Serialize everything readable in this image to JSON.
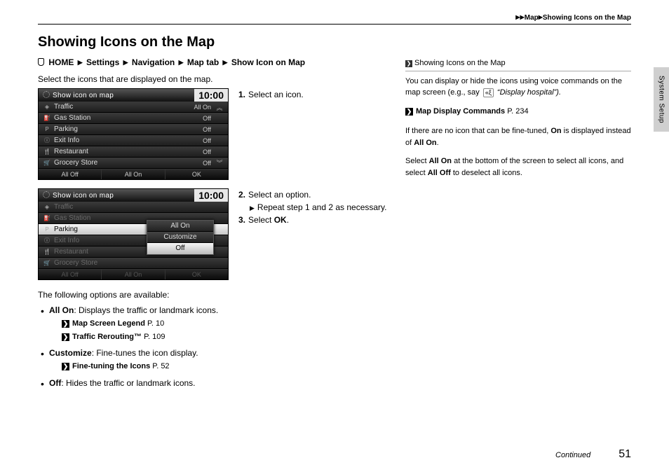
{
  "runhead": {
    "a": "Map",
    "b": "Showing Icons on the Map"
  },
  "title": "Showing Icons on the Map",
  "breadcrumb": [
    "HOME",
    "Settings",
    "Navigation",
    "Map",
    "tab",
    "Show Icon on Map"
  ],
  "intro": "Select the icons that are displayed on the map.",
  "shot1": {
    "title": "Show icon on map",
    "clock": "10:00",
    "rows": [
      {
        "icon": "◈",
        "label": "Traffic",
        "value": "All On"
      },
      {
        "icon": "⛽",
        "label": "Gas Station",
        "value": "Off"
      },
      {
        "icon": "P",
        "label": "Parking",
        "value": "Off"
      },
      {
        "icon": "ⓘ",
        "label": "Exit Info",
        "value": "Off"
      },
      {
        "icon": "🍴",
        "label": "Restaurant",
        "value": "Off"
      },
      {
        "icon": "🛒",
        "label": "Grocery Store",
        "value": "Off"
      }
    ],
    "footer": [
      "All Off",
      "All On",
      "OK"
    ]
  },
  "step1": "Select an icon.",
  "shot2": {
    "title": "Show icon on map",
    "clock": "10:00",
    "rows": [
      {
        "icon": "◈",
        "label": "Traffic",
        "value": ""
      },
      {
        "icon": "⛽",
        "label": "Gas Station",
        "value": ""
      },
      {
        "icon": "P",
        "label": "Parking",
        "value": ""
      },
      {
        "icon": "ⓘ",
        "label": "Exit Info",
        "value": ""
      },
      {
        "icon": "🍴",
        "label": "Restaurant",
        "value": ""
      },
      {
        "icon": "🛒",
        "label": "Grocery Store",
        "value": ""
      }
    ],
    "popup": [
      "All On",
      "Customize",
      "Off"
    ],
    "footer": [
      "All Off",
      "All On",
      "OK"
    ]
  },
  "step2a": "Select an option.",
  "step2b": "Repeat step 1 and 2 as necessary.",
  "step3": "Select OK.",
  "below_lead": "The following options are available:",
  "options": [
    {
      "name": "All On",
      "desc": ": Displays the traffic or landmark icons.",
      "xref": [
        {
          "t": "Map Screen Legend",
          "p": "P. 10"
        },
        {
          "t": "Traffic Rerouting™",
          "p": "P. 109"
        }
      ]
    },
    {
      "name": "Customize",
      "desc": ": Fine-tunes the icon display.",
      "xref": [
        {
          "t": "Fine-tuning the Icons",
          "p": "P. 52"
        }
      ]
    },
    {
      "name": "Off",
      "desc": ": Hides the traffic or landmark icons.",
      "xref": []
    }
  ],
  "right": {
    "heading": "Showing Icons on the Map",
    "p1a": "You can display or hide the icons using voice commands on the map screen (e.g., say ",
    "p1b": " “Display hospital”).",
    "xref": {
      "t": "Map Display Commands",
      "p": "P. 234"
    },
    "p2": "If there are no icon that can be fine-tuned, On is displayed instead of All On.",
    "p3": "Select All On at the bottom of the screen to select all icons, and select All Off to deselect all icons."
  },
  "sidetab": "System Setup",
  "footer": {
    "cont": "Continued",
    "page": "51"
  }
}
